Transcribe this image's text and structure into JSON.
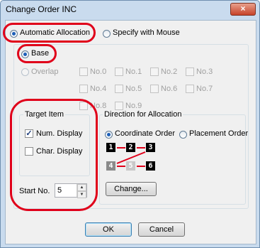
{
  "window": {
    "title": "Change Order INC",
    "close_glyph": "×"
  },
  "mode": {
    "automatic_label": "Automatic Allocation",
    "mouse_label": "Specify with Mouse",
    "selected": "automatic"
  },
  "base": {
    "base_label": "Base",
    "overlap_label": "Overlap",
    "selected": "base"
  },
  "numbers": [
    {
      "label": "No.0",
      "checked": false
    },
    {
      "label": "No.1",
      "checked": false
    },
    {
      "label": "No.2",
      "checked": false
    },
    {
      "label": "No.3",
      "checked": false
    },
    {
      "label": "No.4",
      "checked": false
    },
    {
      "label": "No.5",
      "checked": false
    },
    {
      "label": "No.6",
      "checked": false
    },
    {
      "label": "No.7",
      "checked": false
    },
    {
      "label": "No.8",
      "checked": false
    },
    {
      "label": "No.9",
      "checked": false
    }
  ],
  "target_item": {
    "title": "Target Item",
    "num_display_label": "Num. Display",
    "num_display_checked": true,
    "char_display_label": "Char. Display",
    "char_display_checked": false
  },
  "start_no": {
    "label": "Start No.",
    "value": "5"
  },
  "direction": {
    "title": "Direction for Allocation",
    "coordinate_label": "Coordinate Order",
    "placement_label": "Placement Order",
    "selected": "coordinate",
    "preview_digits_top": [
      "1",
      "2",
      "3"
    ],
    "preview_digits_bottom": [
      "4",
      "5",
      "6"
    ],
    "change_label": "Change..."
  },
  "buttons": {
    "ok_label": "OK",
    "cancel_label": "Cancel"
  },
  "colors": {
    "highlight": "#e0001a",
    "arrow": "#e0001a",
    "selected_radio": "#1d5fb8"
  }
}
